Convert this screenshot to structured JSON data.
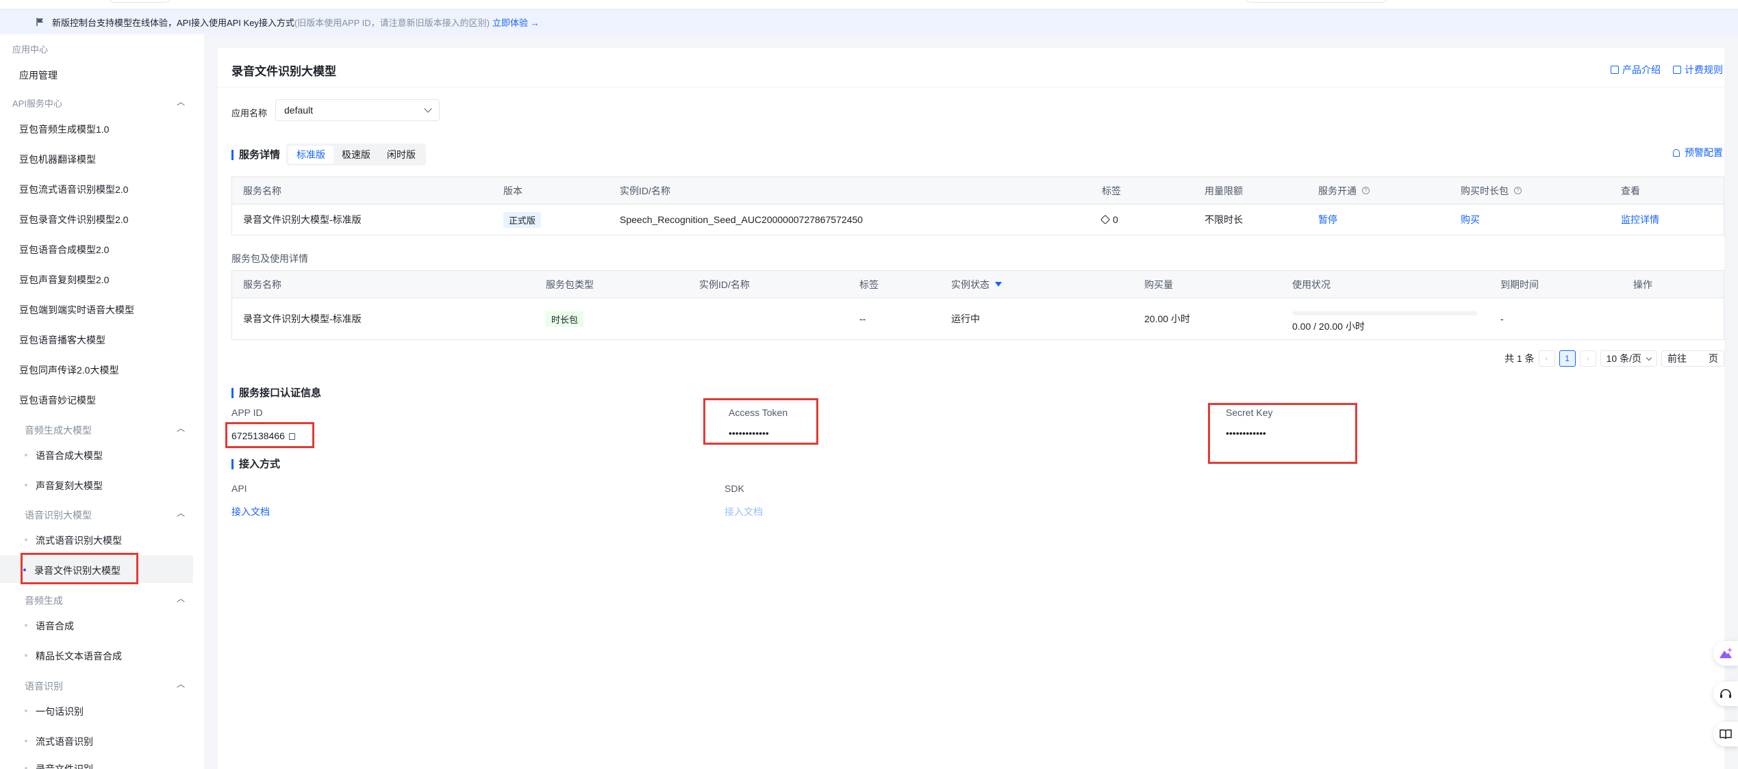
{
  "notice": {
    "text": "新版控制台支持模型在线体验，API接入使用API Key接入方式",
    "muted": "(旧版本使用APP ID，请注意新旧版本接入的区别)",
    "link": "立即体验 →"
  },
  "sidebar": {
    "section1": "应用中心",
    "app_manage": "应用管理",
    "section2": "API服务中心",
    "items": [
      "豆包音频生成模型1.0",
      "豆包机器翻译模型",
      "豆包流式语音识别模型2.0",
      "豆包录音文件识别模型2.0",
      "豆包语音合成模型2.0",
      "豆包声音复刻模型2.0",
      "豆包端到端实时语音大模型",
      "豆包语音播客大模型",
      "豆包同声传译2.0大模型",
      "豆包语音妙记模型"
    ],
    "group_audio_gen": "音频生成大模型",
    "audio_gen_items": [
      "语音合成大模型",
      "声音复刻大模型"
    ],
    "group_asr_big": "语音识别大模型",
    "asr_big_items": [
      "流式语音识别大模型",
      "录音文件识别大模型"
    ],
    "group_gen": "音频生成",
    "gen_items": [
      "语音合成",
      "精品长文本语音合成"
    ],
    "group_asr": "语音识别",
    "asr_items": [
      "一句话识别",
      "流式语音识别",
      "录音文件识别"
    ]
  },
  "page": {
    "title": "录音文件识别大模型",
    "product_intro": "产品介绍",
    "billing_rules": "计费规则",
    "app_name_label": "应用名称",
    "app_name_value": "default"
  },
  "service": {
    "title": "服务详情",
    "tabs": [
      "标准版",
      "极速版",
      "闲时版"
    ],
    "alarm": "预警配置",
    "headers": [
      "服务名称",
      "版本",
      "实例ID/名称",
      "标签",
      "用量限额",
      "服务开通",
      "购买时长包",
      "查看"
    ],
    "row": {
      "name": "录音文件识别大模型-标准版",
      "version": "正式版",
      "instance": "Speech_Recognition_Seed_AUC2000000727867572450",
      "tags": "0",
      "limit": "不限时长",
      "open": "暂停",
      "buy": "购买",
      "view": "监控详情"
    }
  },
  "packages": {
    "label": "服务包及使用详情",
    "headers": [
      "服务名称",
      "服务包类型",
      "实例ID/名称",
      "标签",
      "实例状态",
      "购买量",
      "使用状况",
      "到期时间",
      "操作"
    ],
    "row": {
      "name": "录音文件识别大模型-标准版",
      "type": "时长包",
      "instance": "",
      "tags": "--",
      "status": "运行中",
      "amount": "20.00 小时",
      "usage": "0.00 / 20.00 小时",
      "usage_fraction": 0,
      "expire": "-",
      "action": ""
    },
    "pager": {
      "total": "共 1 条",
      "current": "1",
      "page_size": "10 条/页",
      "goto": "前往",
      "page_unit": "页"
    }
  },
  "auth": {
    "title": "服务接口认证信息",
    "app_id_label": "APP ID",
    "app_id_value": "6725138466",
    "access_token_label": "Access Token",
    "access_token_value": "••••••••••••",
    "secret_key_label": "Secret Key",
    "secret_key_value": "••••••••••••"
  },
  "access": {
    "title": "接入方式",
    "api_label": "API",
    "api_link": "接入文档",
    "sdk_label": "SDK",
    "sdk_link": "接入文档"
  },
  "colors": {
    "accent": "#1664ff",
    "highlight_box": "#e53935"
  }
}
